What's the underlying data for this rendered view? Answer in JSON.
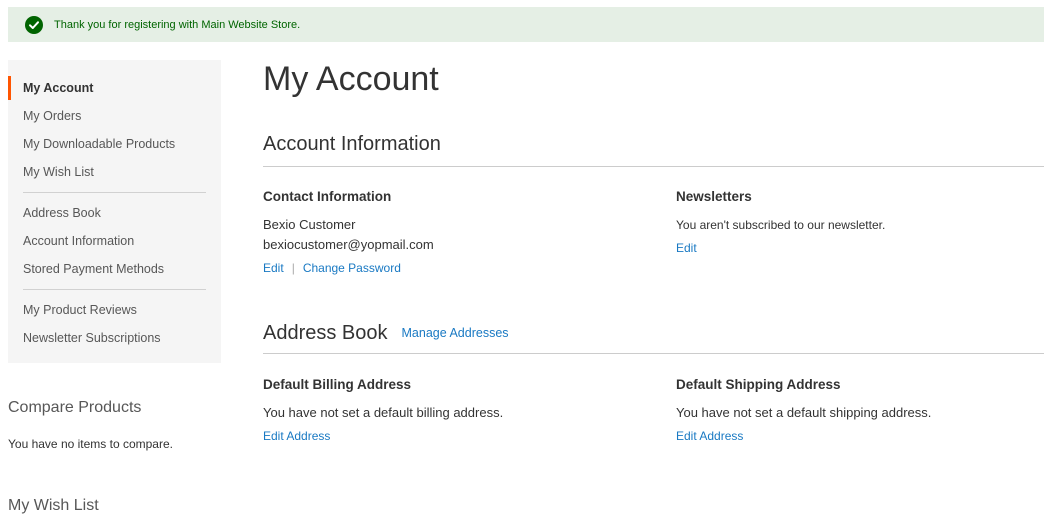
{
  "message": {
    "text": "Thank you for registering with Main Website Store.",
    "icon": "checkmark-circle-icon",
    "color": "#006400",
    "background": "#e5efe5"
  },
  "sidebar": {
    "items": [
      {
        "label": "My Account",
        "current": true
      },
      {
        "label": "My Orders"
      },
      {
        "label": "My Downloadable Products"
      },
      {
        "label": "My Wish List"
      },
      {
        "label": "Address Book"
      },
      {
        "label": "Account Information"
      },
      {
        "label": "Stored Payment Methods"
      },
      {
        "label": "My Product Reviews"
      },
      {
        "label": "Newsletter Subscriptions"
      }
    ],
    "accent_color": "#ff5501"
  },
  "compare": {
    "title": "Compare Products",
    "empty_text": "You have no items to compare."
  },
  "wishlist": {
    "title": "My Wish List"
  },
  "main": {
    "page_title": "My Account",
    "account_info": {
      "title": "Account Information",
      "contact": {
        "title": "Contact Information",
        "name": "Bexio Customer",
        "email": "bexiocustomer@yopmail.com",
        "edit_label": "Edit",
        "separator": "|",
        "change_password_label": "Change Password"
      },
      "newsletters": {
        "title": "Newsletters",
        "text": "You aren't subscribed to our newsletter.",
        "edit_label": "Edit"
      }
    },
    "address_book": {
      "title": "Address Book",
      "manage_label": "Manage Addresses",
      "billing": {
        "title": "Default Billing Address",
        "text": "You have not set a default billing address.",
        "edit_label": "Edit Address"
      },
      "shipping": {
        "title": "Default Shipping Address",
        "text": "You have not set a default shipping address.",
        "edit_label": "Edit Address"
      }
    },
    "link_color": "#1979c3"
  }
}
